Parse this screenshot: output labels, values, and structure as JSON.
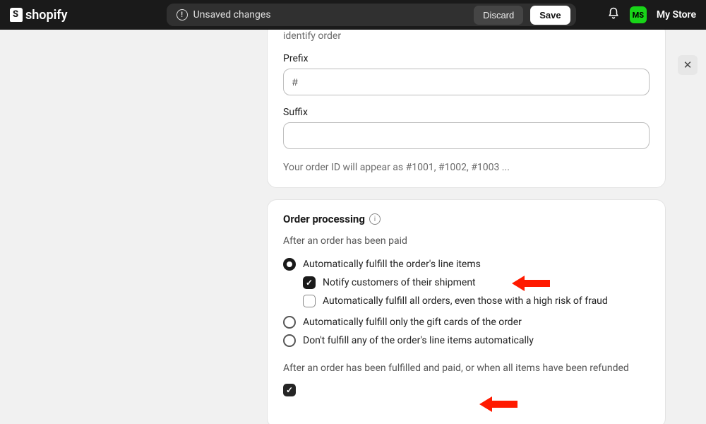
{
  "topbar": {
    "brand": "shopify",
    "unsaved": "Unsaved changes",
    "discard": "Discard",
    "save": "Save",
    "store_initials": "MS",
    "store_name": "My Store"
  },
  "order_id": {
    "intro": "identify order",
    "prefix_label": "Prefix",
    "prefix_value": "#",
    "suffix_label": "Suffix",
    "suffix_value": "",
    "preview": "Your order ID will appear as #1001, #1002, #1003 ..."
  },
  "processing": {
    "title": "Order processing",
    "after_paid": "After an order has been paid",
    "opt_auto_fulfill": "Automatically fulfill the order's line items",
    "opt_notify": "Notify customers of their shipment",
    "opt_fulfill_high_risk": "Automatically fulfill all orders, even those with a high risk of fraud",
    "opt_gift_only": "Automatically fulfill only the gift cards of the order",
    "opt_none": "Don't fulfill any of the order's line items automatically",
    "after_fulfilled": "After an order has been fulfilled and paid, or when all items have been refunded"
  }
}
